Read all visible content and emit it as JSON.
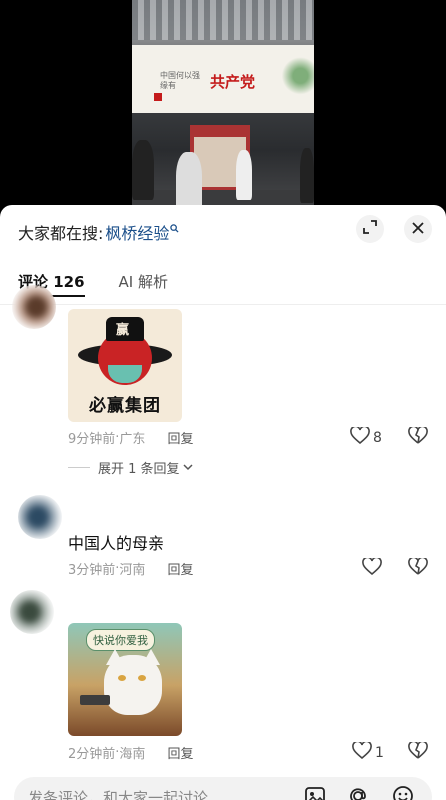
{
  "video": {
    "billboard_small": "中国何以强\n缘有",
    "billboard_big": "共产党"
  },
  "search": {
    "prefix": "大家都在搜:",
    "link": "枫桥经验"
  },
  "tabs": [
    {
      "label": "评论 126"
    },
    {
      "label": "AI 解析"
    }
  ],
  "comments": [
    {
      "image_text": "必赢集团",
      "image_hat_char": "赢",
      "time": "9分钟前",
      "location": "广东",
      "reply_label": "回复",
      "likes": "8",
      "expand_label": "展开 1 条回复"
    },
    {
      "text": "中国人的母亲",
      "time": "3分钟前",
      "location": "河南",
      "reply_label": "回复"
    },
    {
      "image_bubble": "快说你爱我",
      "time": "2分钟前",
      "location": "海南",
      "reply_label": "回复",
      "likes": "1"
    }
  ],
  "input": {
    "placeholder": "发条评论，和大家一起讨论"
  },
  "icons": {
    "search_link": "search-icon",
    "expand": "expand-icon",
    "close": "close-icon",
    "like": "heart-icon",
    "dislike": "broken-heart-icon",
    "image": "image-icon",
    "mention": "at-icon",
    "emoji": "emoji-icon"
  }
}
